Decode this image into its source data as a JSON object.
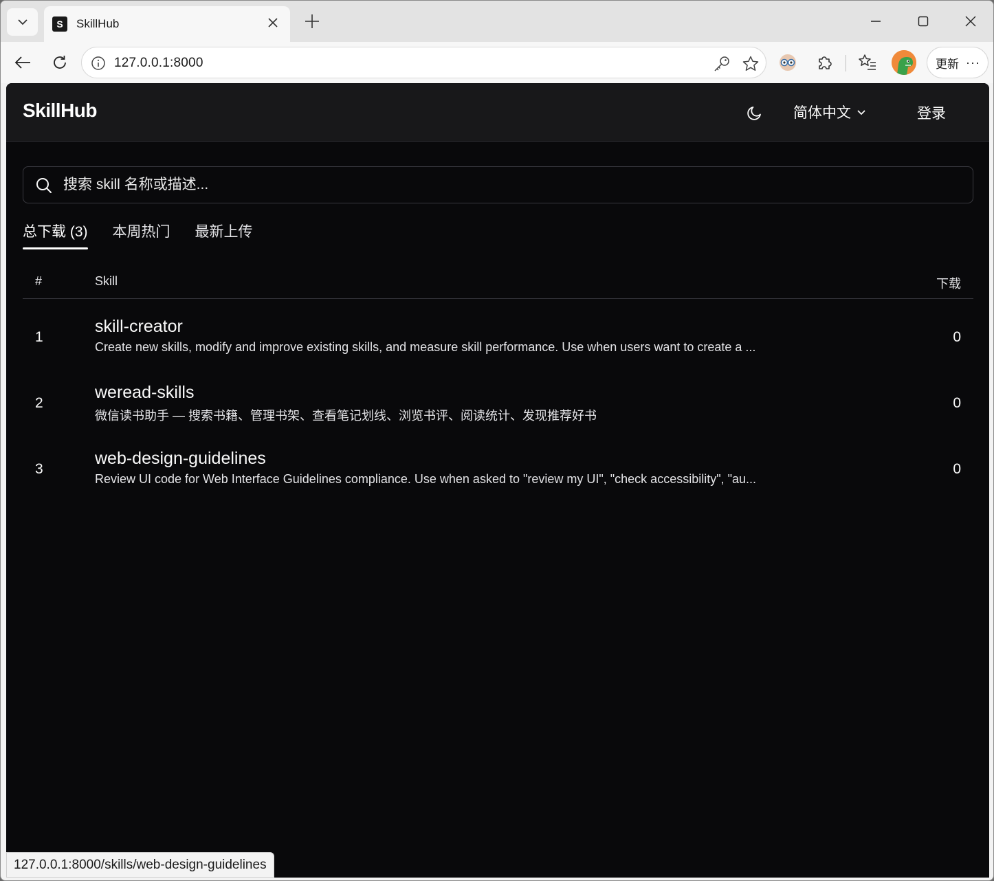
{
  "browser": {
    "tab_title": "SkillHub",
    "favicon_letter": "S",
    "url": "127.0.0.1:8000",
    "update_label": "更新",
    "more_label": "···",
    "status_url": "127.0.0.1:8000/skills/web-design-guidelines"
  },
  "header": {
    "brand": "SkillHub",
    "language": "简体中文",
    "login": "登录"
  },
  "search": {
    "placeholder": "搜索 skill 名称或描述..."
  },
  "tabs": [
    {
      "label": "总下载 (3)",
      "active": true
    },
    {
      "label": "本周热门",
      "active": false
    },
    {
      "label": "最新上传",
      "active": false
    }
  ],
  "table": {
    "columns": {
      "rank": "#",
      "skill": "Skill",
      "downloads": "下载"
    },
    "rows": [
      {
        "rank": "1",
        "name": "skill-creator",
        "description": "Create new skills, modify and improve existing skills, and measure skill performance. Use when users want to create a ...",
        "downloads": "0"
      },
      {
        "rank": "2",
        "name": "weread-skills",
        "description": "微信读书助手 — 搜索书籍、管理书架、查看笔记划线、浏览书评、阅读统计、发现推荐好书",
        "downloads": "0"
      },
      {
        "rank": "3",
        "name": "web-design-guidelines",
        "description": "Review UI code for Web Interface Guidelines compliance. Use when asked to \"review my UI\", \"check accessibility\", \"au...",
        "downloads": "0"
      }
    ]
  },
  "colors": {
    "page_bg": "#09090b",
    "header_bg": "#18181a",
    "text": "#fafafa",
    "border": "#34343a"
  }
}
